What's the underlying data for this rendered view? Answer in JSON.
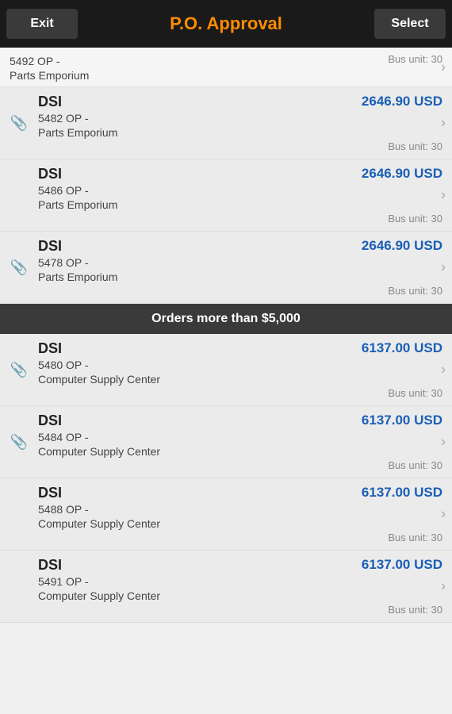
{
  "header": {
    "exit_label": "Exit",
    "title": "P.O. Approval",
    "select_label": "Select"
  },
  "partial_item": {
    "op_number": "5492 OP -",
    "vendor": "Parts Emporium",
    "bus_unit": "Bus unit: 30"
  },
  "items_under_5000": [
    {
      "id": "item-1",
      "name": "DSI",
      "op_number": "5482 OP -",
      "vendor": "Parts Emporium",
      "amount": "2646.90 USD",
      "bus_unit": "Bus unit: 30",
      "has_attachment": true
    },
    {
      "id": "item-2",
      "name": "DSI",
      "op_number": "5486 OP -",
      "vendor": "Parts Emporium",
      "amount": "2646.90 USD",
      "bus_unit": "Bus unit: 30",
      "has_attachment": false
    },
    {
      "id": "item-3",
      "name": "DSI",
      "op_number": "5478 OP -",
      "vendor": "Parts Emporium",
      "amount": "2646.90 USD",
      "bus_unit": "Bus unit: 30",
      "has_attachment": true
    }
  ],
  "section_header": {
    "label": "Orders more than $5,000"
  },
  "items_over_5000": [
    {
      "id": "item-4",
      "name": "DSI",
      "op_number": "5480 OP -",
      "vendor": "Computer Supply Center",
      "amount": "6137.00 USD",
      "bus_unit": "Bus unit: 30",
      "has_attachment": true
    },
    {
      "id": "item-5",
      "name": "DSI",
      "op_number": "5484 OP -",
      "vendor": "Computer Supply Center",
      "amount": "6137.00 USD",
      "bus_unit": "Bus unit: 30",
      "has_attachment": true
    },
    {
      "id": "item-6",
      "name": "DSI",
      "op_number": "5488 OP -",
      "vendor": "Computer Supply Center",
      "amount": "6137.00 USD",
      "bus_unit": "Bus unit: 30",
      "has_attachment": false
    },
    {
      "id": "item-7",
      "name": "DSI",
      "op_number": "5491 OP -",
      "vendor": "Computer Supply Center",
      "amount": "6137.00 USD",
      "bus_unit": "Bus unit: 30",
      "has_attachment": false
    }
  ],
  "icons": {
    "attachment": "📎",
    "chevron": "›"
  }
}
